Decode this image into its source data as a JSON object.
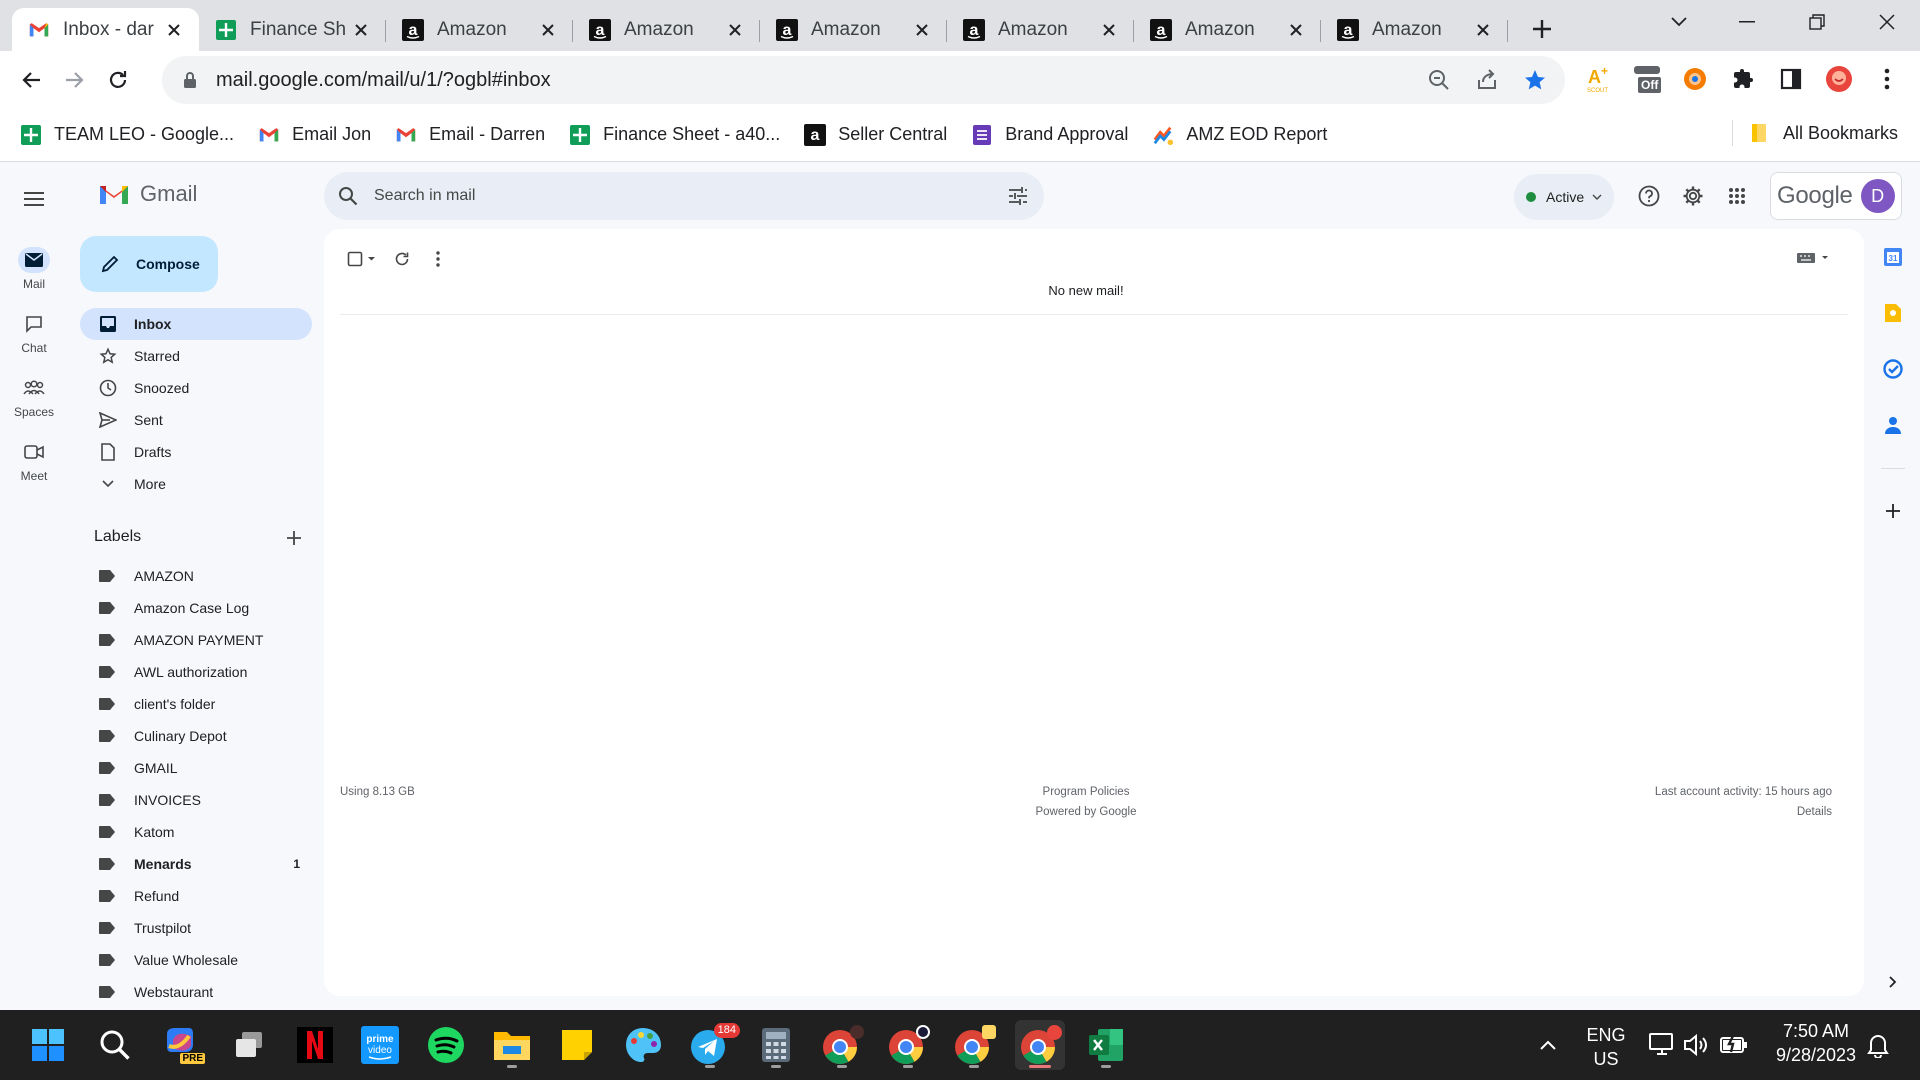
{
  "browser": {
    "tabs": [
      {
        "title": "Inbox - dar",
        "favicon": "gmail-icon",
        "active": true
      },
      {
        "title": "Finance Sh",
        "favicon": "sheets-icon",
        "active": false
      },
      {
        "title": "Amazon",
        "favicon": "amazon-icon",
        "active": false
      },
      {
        "title": "Amazon",
        "favicon": "amazon-icon",
        "active": false
      },
      {
        "title": "Amazon",
        "favicon": "amazon-icon",
        "active": false
      },
      {
        "title": "Amazon",
        "favicon": "amazon-icon",
        "active": false
      },
      {
        "title": "Amazon",
        "favicon": "amazon-icon",
        "active": false
      },
      {
        "title": "Amazon",
        "favicon": "amazon-icon",
        "active": false
      }
    ],
    "url": "mail.google.com/mail/u/1/?ogbl#inbox",
    "ext_off_badge": "Off",
    "bookmarks": [
      {
        "label": "TEAM LEO - Google...",
        "icon": "sheets-icon"
      },
      {
        "label": "Email Jon",
        "icon": "gmail-icon"
      },
      {
        "label": "Email - Darren",
        "icon": "gmail-icon"
      },
      {
        "label": "Finance Sheet - a40...",
        "icon": "sheets-icon"
      },
      {
        "label": "Seller Central",
        "icon": "amazon-icon"
      },
      {
        "label": "Brand Approval",
        "icon": "forms-icon"
      },
      {
        "label": "AMZ EOD Report",
        "icon": "report-icon"
      }
    ],
    "all_bookmarks": "All Bookmarks"
  },
  "gmail": {
    "brand": "Gmail",
    "rail": [
      {
        "label": "Mail",
        "icon": "mail-icon"
      },
      {
        "label": "Chat",
        "icon": "chat-icon"
      },
      {
        "label": "Spaces",
        "icon": "spaces-icon"
      },
      {
        "label": "Meet",
        "icon": "meet-icon"
      }
    ],
    "compose": "Compose",
    "nav": [
      {
        "label": "Inbox",
        "icon": "inbox-icon"
      },
      {
        "label": "Starred",
        "icon": "star-icon"
      },
      {
        "label": "Snoozed",
        "icon": "clock-icon"
      },
      {
        "label": "Sent",
        "icon": "send-icon"
      },
      {
        "label": "Drafts",
        "icon": "draft-icon"
      },
      {
        "label": "More",
        "icon": "chevron-down-icon"
      }
    ],
    "labels_title": "Labels",
    "labels": [
      {
        "name": "AMAZON",
        "count": ""
      },
      {
        "name": "Amazon Case Log",
        "count": ""
      },
      {
        "name": "AMAZON PAYMENT",
        "count": ""
      },
      {
        "name": "AWL authorization",
        "count": ""
      },
      {
        "name": "client's folder",
        "count": ""
      },
      {
        "name": "Culinary Depot",
        "count": ""
      },
      {
        "name": "GMAIL",
        "count": ""
      },
      {
        "name": "INVOICES",
        "count": ""
      },
      {
        "name": "Katom",
        "count": ""
      },
      {
        "name": "Menards",
        "count": "1"
      },
      {
        "name": "Refund",
        "count": ""
      },
      {
        "name": "Trustpilot",
        "count": ""
      },
      {
        "name": "Value Wholesale",
        "count": ""
      },
      {
        "name": "Webstaurant",
        "count": ""
      }
    ],
    "search_placeholder": "Search in mail",
    "status": "Active",
    "google_wordmark": "Google",
    "avatar_initial": "D",
    "empty_message": "No new mail!",
    "footer": {
      "storage": "Using 8.13 GB",
      "policies": "Program Policies",
      "powered": "Powered by Google",
      "activity": "Last account activity: 15 hours ago",
      "details": "Details"
    }
  },
  "taskbar": {
    "telegram_badge": "184",
    "lang_top": "ENG",
    "lang_bottom": "US",
    "time": "7:50 AM",
    "date": "9/28/2023",
    "pre_badge": "PRE"
  }
}
